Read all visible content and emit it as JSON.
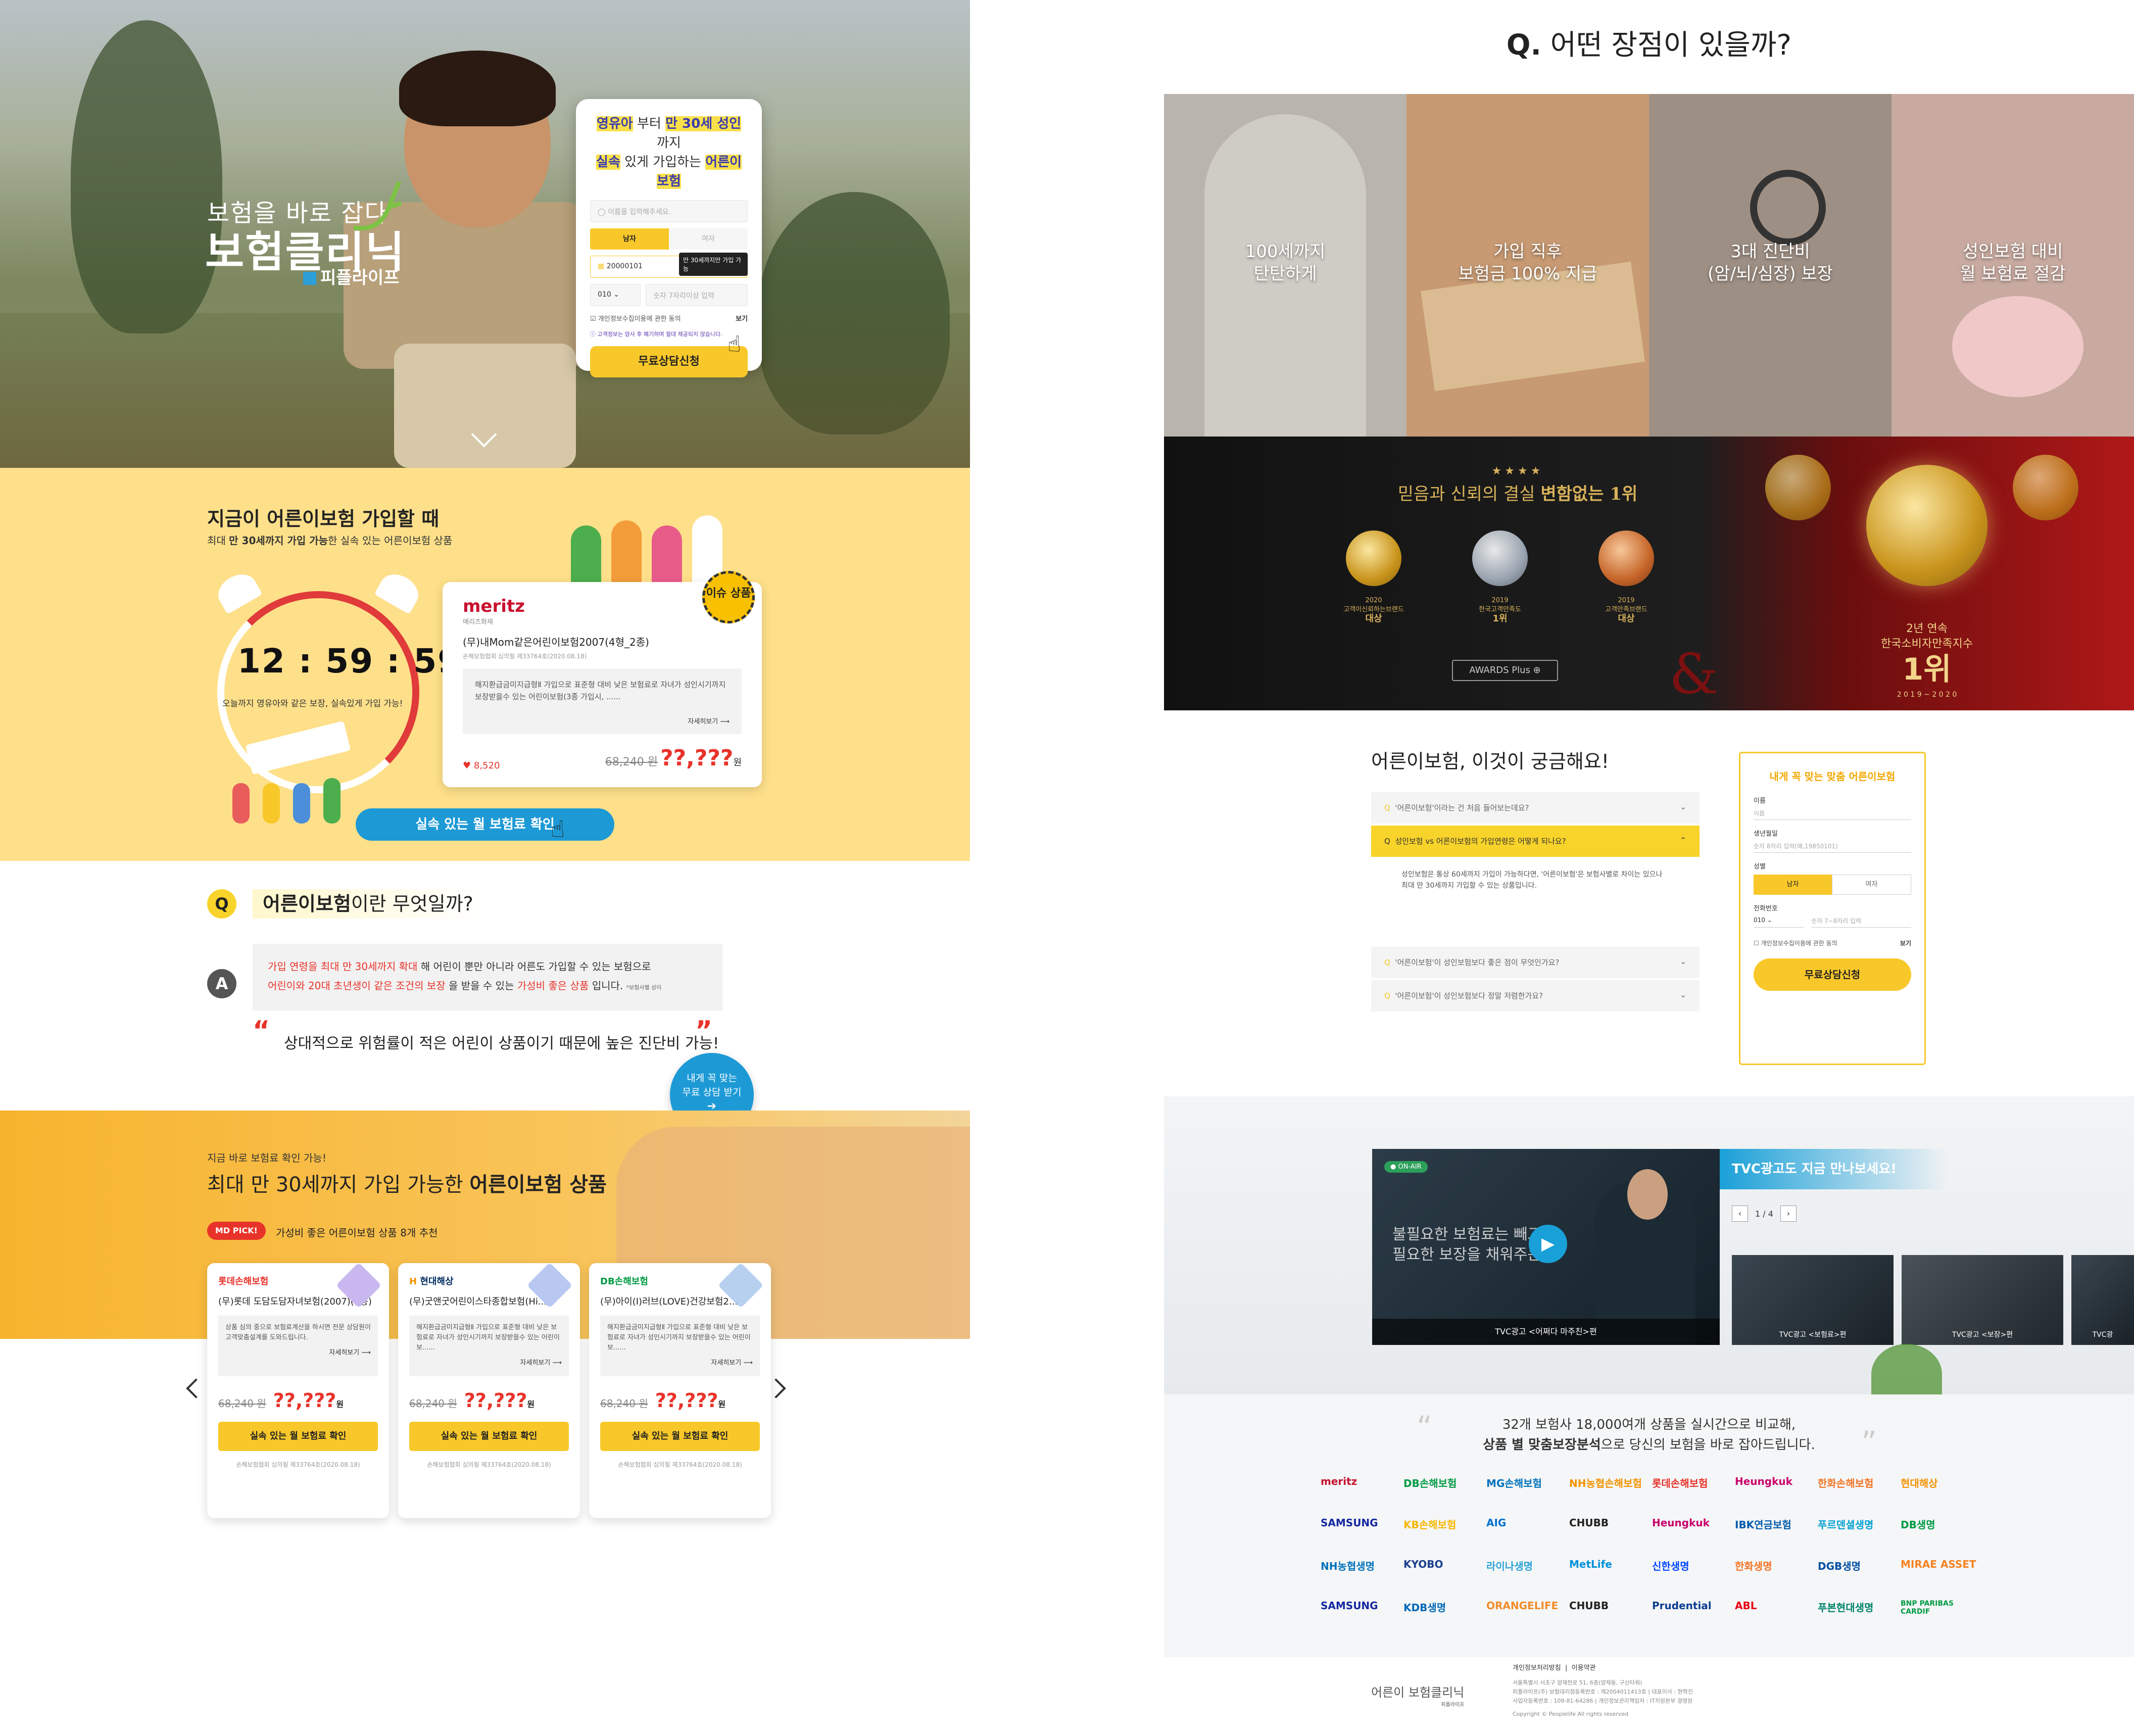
{
  "left": {
    "hero": {
      "subtitle": "보험을 바로 잡다",
      "title": "보험클리닉",
      "brand": "피플라이프",
      "form": {
        "headline_1a": "영유아",
        "headline_1b": " 부터 ",
        "headline_1c": "만 30세 성인",
        "headline_1d": " 까지",
        "headline_2a": "실속",
        "headline_2b": " 있게 가입하는 ",
        "headline_2c": "어른이 보험",
        "name_placeholder": "이름을 입력해주세요.",
        "gender_male": "남자",
        "gender_female": "여자",
        "birth_value": "20000101",
        "birth_tip": "만 30세까지만 가입 가능",
        "phone_prefix": "010",
        "phone_placeholder": "숫자 7자리이상 입력",
        "consent_label": "개인정보수집이용에 관한 동의",
        "consent_view": "보기",
        "notice": "고객정보는 암사 후 폐기하며 절대 제공되지 않습니다.",
        "submit": "무료상담신청"
      }
    },
    "timer": {
      "title": "지금이 어른이보험 가입할 때",
      "sub_a": "최대 ",
      "sub_b": "만 30세까지 가입 가능",
      "sub_c": "한 실속 있는 어른이보험 상품",
      "time": "12 : 59 : 59",
      "note": "오늘까지 영유아와 같은 보장, 실속있게 가입 가능!",
      "card": {
        "brand": "meritz",
        "brand_sub": "메리츠화재",
        "badge": "이슈 상품",
        "name": "(무)내Mom같은어린이보험2007(4형_2종)",
        "reg": "손해보험협회 심의필 제33764호(2020.08.18)",
        "desc": "해지환급금미지급형Ⅱ 가입으로 표준형 대비 낮은 보험료로 자녀가 성인시기까지 보장받을수 있는 어린이보험(3종 가입시, ......",
        "more": "자세히보기",
        "likes": "8,520",
        "old_price": "68,240 원",
        "new_price": "??,???",
        "unit": "원"
      },
      "cta": "실속 있는 월 보험료 확인"
    },
    "qa": {
      "q_mark": "Q",
      "question_a": "어른이보험",
      "question_b": "이란 무엇일까?",
      "a_mark": "A",
      "answer_line1_a": "가입 연령을 최대 만 30세까지 확대",
      "answer_line1_b": " 해 어린이 뿐만 아니라 어른도 가입할 수 있는 보험으로",
      "answer_line2_a": "어린이와 20대 초년생이 같은 조건의 보장",
      "answer_line2_b": " 을 받을 수 있는 ",
      "answer_line2_c": "가성비 좋은 상품",
      "answer_line2_d": " 입니다.",
      "answer_note": "*보험사별 상이",
      "quote": "상대적으로 위험률이 적은 어린이 상품이기 때문에 높은 진단비 가능!",
      "float_btn_1": "내게 꼭 맞는",
      "float_btn_2": "무료 상담 받기"
    },
    "products": {
      "kicker": "지금 바로 보험료 확인 가능!",
      "title_a": "최대 만 30세까지 가입 가능한 ",
      "title_b": "어른이보험 상품",
      "pick_badge": "MD PICK!",
      "pick_text": "가성비 좋은 어른이보험 상품 8개 추천",
      "items": [
        {
          "brand": "롯데손해보험",
          "name": "(무)롯데 도담도담자녀보험(2007)(9종)",
          "desc": "상품 심의 중으로 보험료계산을 하시면 전문 상담원이 고객맞춤설계를 도와드립니다.",
          "more": "자세히보기",
          "old": "68,240 원",
          "price": "??,???",
          "unit": "원",
          "cta": "실속 있는 월 보험료 확인",
          "reg": "손해보험협회 심의필 제33764호(2020.08.18)",
          "color": "#e8332a"
        },
        {
          "brand": "현대해상",
          "name": "(무)굿앤굿어린이스타종합보험(Hi...",
          "desc": "해지환급금미지급형Ⅱ 가입으로 표준형 대비 낮은 보험료로 자녀가 성인시기까지 보장받을수 있는 어린이보......",
          "more": "자세히보기",
          "old": "68,240 원",
          "price": "??,???",
          "unit": "원",
          "cta": "실속 있는 월 보험료 확인",
          "reg": "손해보험협회 심의필 제33764호(2020.08.18)",
          "color": "#f39200"
        },
        {
          "brand": "DB손해보험",
          "name": "(무)아이(I)러브(LOVE)건강보험2...",
          "desc": "해지환급금미지급형Ⅱ 가입으로 표준형 대비 낮은 보험료로 자녀가 성인시기까지 보장받을수 있는 어린이보......",
          "more": "자세히보기",
          "old": "68,240 원",
          "price": "??,???",
          "unit": "원",
          "cta": "실속 있는 월 보험료 확인",
          "reg": "손해보험협회 심의필 제33764호(2020.08.18)",
          "color": "#009a44"
        }
      ]
    }
  },
  "right": {
    "title_q": "Q.",
    "title": "어떤 장점이 있을까?",
    "benefits": [
      {
        "line1": "100세까지",
        "line2": "탄탄하게",
        "bg": "#b9b4ae"
      },
      {
        "line1": "가입 직후",
        "line2": "보험금 100% 지급",
        "bg": "#c79a73"
      },
      {
        "line1": "3대 진단비",
        "line2": "(암/뇌/심장) 보장",
        "bg": "#9e8f84"
      },
      {
        "line1": "성인보험 대비",
        "line2": "월 보험료 절감",
        "bg": "#c8aaa0"
      }
    ],
    "awards": {
      "stars": "★★★★",
      "headline_a": "믿음과 신뢰의 결실 ",
      "headline_b": "변함없는 1위",
      "items": [
        {
          "year": "2020",
          "org": "고객이신뢰하는브랜드",
          "rank": "대상"
        },
        {
          "year": "2019",
          "org": "한국고객만족도",
          "rank": "1위"
        },
        {
          "year": "2019",
          "org": "고객만족브랜드",
          "rank": "대상"
        }
      ],
      "plus_btn": "AWARDS Plus",
      "big_line1": "2년 연속",
      "big_line2": "한국소비자만족지수",
      "big_rank": "1위",
      "big_years": "2 0 1 9 ~ 2 0 2 0",
      "amp": "&"
    },
    "faq": {
      "title": "어른이보험, 이것이 궁금해요!",
      "items": [
        "'어른이보험'이라는 건 처음 들어보는데요?",
        "성인보험 vs 어른이보험의 가입연령은 어떻게 되나요?",
        "'어른이보험'이 성인보험보다 좋은 점이 무엇인가요?",
        "'어른이보험'이 성인보험보다 정말 저렴한가요?"
      ],
      "answer": "성인보험은 통상 60세까지 가입이 가능하다면, '어른이보험'은 보험사별로 차이는 있으나 최대 만 30세까지 가입할 수 있는 상품입니다."
    },
    "side_form": {
      "title_a": "내게 꼭 맞는 ",
      "title_b": "맞춤 어른이보험",
      "name_label": "이름",
      "name_placeholder": "이름",
      "birth_label": "생년월일",
      "birth_placeholder": "숫자 8자리 입력(예,19850101)",
      "gender_label": "성별",
      "male": "남자",
      "female": "여자",
      "phone_label": "전화번호",
      "phone_prefix": "010",
      "phone_placeholder": "숫자 7~8자리 입력",
      "consent": "개인정보수집이용에 관한 동의",
      "consent_view": "보기",
      "submit": "무료상담신청"
    },
    "tvc": {
      "on_air": "ON-AIR",
      "caption_1": "불필요한 보험료는 빼고",
      "caption_2": "필요한 보장을 채워주는",
      "main_label": "TVC광고 <어쩌다 마주친>편",
      "banner": "TVC광고도 지금 만나보세요!",
      "pager": "1 / 4",
      "thumbs": [
        "TVC광고 <보험료>편",
        "TVC광고 <보장>편",
        "TVC광"
      ]
    },
    "partners": {
      "line1": "32개 보험사 18,000여개 상품을 실시간으로 비교해,",
      "line2_a": "상품 별 맞춤보장분석",
      "line2_b": "으로 당신의 보험을 바로 잡아드립니다.",
      "logos": [
        [
          "meritz",
          "DB손해보험",
          "MG손해보험",
          "NH농협손해보험",
          "롯데손해보험",
          "Heungkuk",
          "한화손해보험",
          "현대해상"
        ],
        [
          "SAMSUNG",
          "KB손해보험",
          "AIG",
          "CHUBB",
          "Heungkuk",
          "IBK연금보험",
          "푸르덴셜생명",
          "DB생명"
        ],
        [
          "NH농협생명",
          "KYOBO",
          "라이나생명",
          "MetLife",
          "신한생명",
          "한화생명",
          "DGB생명",
          "MIRAE ASSET"
        ],
        [
          "SAMSUNG",
          "KDB생명",
          "ORANGELIFE",
          "CHUBB",
          "Prudential",
          "ABL",
          "푸본현대생명",
          "BNP PARIBAS CARDIF"
        ]
      ],
      "logo_colors": [
        [
          "#c8102e",
          "#009a44",
          "#0072bc",
          "#f39200",
          "#e8332a",
          "#c8006b",
          "#f37321",
          "#f39200"
        ],
        [
          "#1428a0",
          "#f6b800",
          "#0072ce",
          "#222222",
          "#c8006b",
          "#005bac",
          "#00a0d2",
          "#009a44"
        ],
        [
          "#0072bc",
          "#1a3f8f",
          "#2aa3d8",
          "#0090da",
          "#0046ff",
          "#f37321",
          "#004ea2",
          "#f58220"
        ],
        [
          "#1428a0",
          "#0068b7",
          "#f28c28",
          "#222222",
          "#0b3d91",
          "#e60012",
          "#00836b",
          "#009a44"
        ]
      ]
    },
    "footer": {
      "logo": "어른이 보험클리닉",
      "logo_sub": "피플라이프",
      "link_privacy": "개인정보처리방침",
      "link_terms": "이용약관",
      "addr": "서울특별시 서초구 양재천로 51, 6층(양재동, 구산타워)",
      "company": "피플라이프(주)  보험대리점등록번호 : 제2004011413호  |  대표이사 : 현학진",
      "biz": "사업자등록번호 : 109-81-64286  |  개인정보관리책임자 : IT지원본부 경영원",
      "copyright": "Copyright © Peoplelife All rights reserved"
    }
  }
}
